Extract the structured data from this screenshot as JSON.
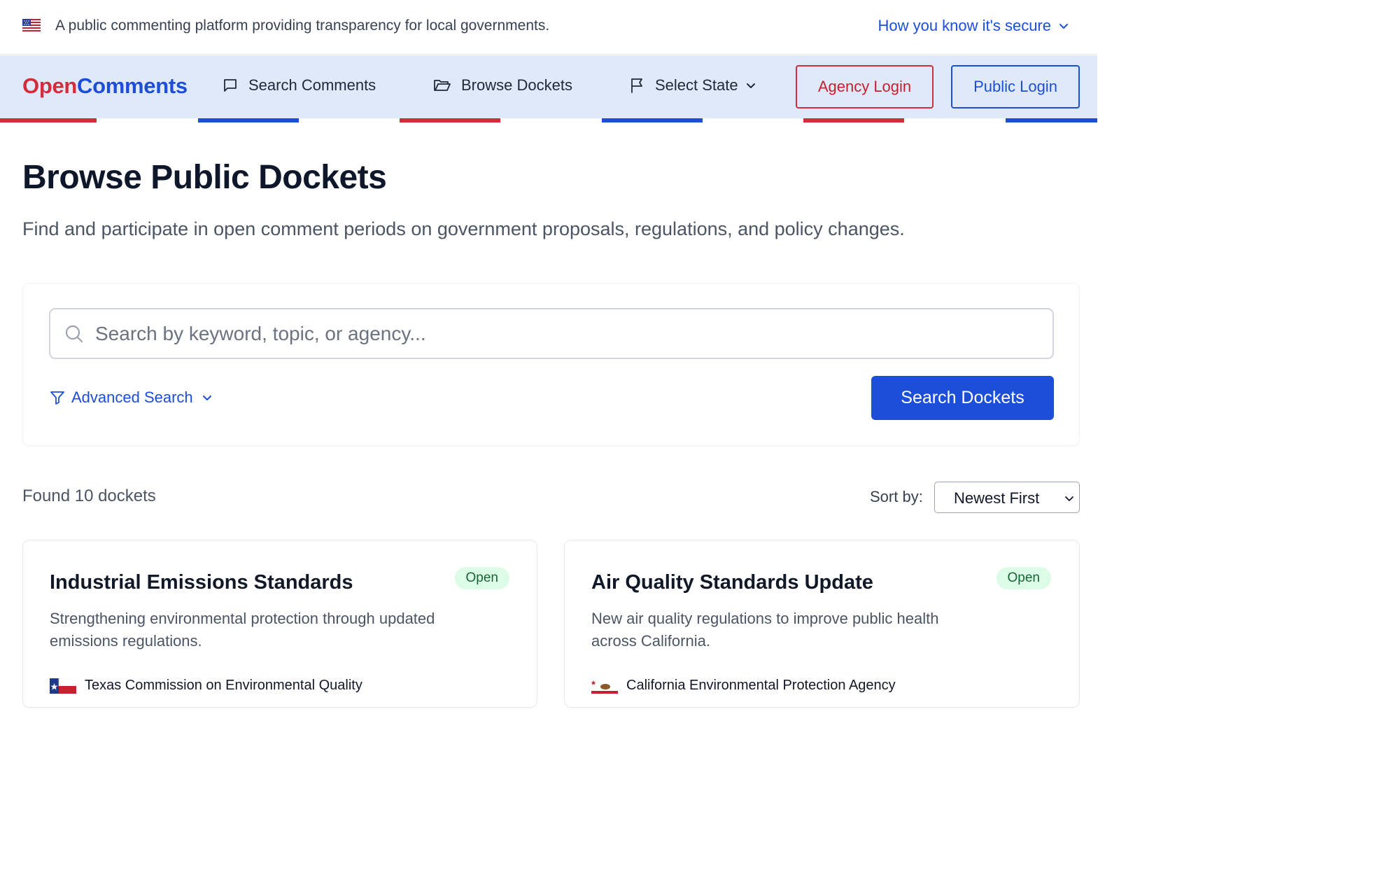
{
  "banner": {
    "tagline": "A public commenting platform providing transparency for local governments.",
    "secure_link": "How you know it's secure"
  },
  "nav": {
    "brand_part1": "Open",
    "brand_part2": "Comments",
    "items": [
      {
        "label": "Search Comments",
        "icon": "message-square-icon"
      },
      {
        "label": "Browse Dockets",
        "icon": "folder-open-icon"
      },
      {
        "label": "Select State",
        "icon": "flag-icon"
      }
    ],
    "agency_login": "Agency Login",
    "public_login": "Public Login"
  },
  "colors": {
    "brand_red": "#d02e3a",
    "brand_blue": "#1d4ed8",
    "nav_bg": "#dfe9f9",
    "badge_bg": "#dcfce7",
    "badge_text": "#166534"
  },
  "main": {
    "title": "Browse Public Dockets",
    "subtitle": "Find and participate in open comment periods on government proposals, regulations, and policy changes."
  },
  "search": {
    "placeholder": "Search by keyword, topic, or agency...",
    "value": "",
    "advanced_label": "Advanced Search",
    "submit_label": "Search Dockets"
  },
  "results": {
    "found_text": "Found 10 dockets",
    "sort_label": "Sort by:",
    "sort_value": "Newest First"
  },
  "dockets": [
    {
      "title": "Industrial Emissions Standards",
      "status": "Open",
      "description": "Strengthening environmental protection through updated emissions regulations.",
      "agency": "Texas Commission on Environmental Quality",
      "agency_icon": "texas-flag-icon"
    },
    {
      "title": "Air Quality Standards Update",
      "status": "Open",
      "description": "New air quality regulations to improve public health across California.",
      "agency": "California Environmental Protection Agency",
      "agency_icon": "california-flag-icon"
    }
  ]
}
